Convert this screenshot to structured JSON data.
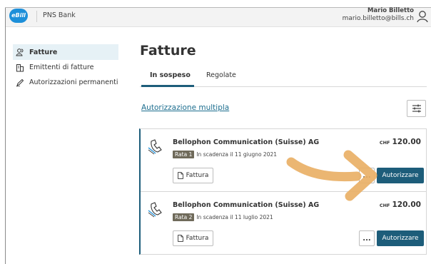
{
  "topbar": {
    "logo_text": "eBill",
    "bank_name": "PNS Bank",
    "user_name": "Mario Billetto",
    "user_email": "mario.billetto@bills.ch"
  },
  "sidebar": {
    "items": [
      {
        "label": "Fatture",
        "icon": "users-icon",
        "active": true
      },
      {
        "label": "Emittenti di fatture",
        "icon": "building-icon",
        "active": false
      },
      {
        "label": "Autorizzazioni permanenti",
        "icon": "pen-icon",
        "active": false
      }
    ]
  },
  "main": {
    "title": "Fatture",
    "tabs": [
      {
        "label": "In sospeso",
        "active": true
      },
      {
        "label": "Regolate",
        "active": false
      }
    ],
    "multi_auth_link": "Autorizzazione multipla",
    "bills": [
      {
        "issuer": "Bellophon Communication (Suisse) AG",
        "currency": "CHF",
        "amount": "120.00",
        "installment": "Rata 1",
        "due_text": "In scadenza il 11 giugno 2021",
        "invoice_label": "Fattura",
        "more_label": "...",
        "authorize_label": "Autorizzare"
      },
      {
        "issuer": "Bellophon Communication (Suisse) AG",
        "currency": "CHF",
        "amount": "120.00",
        "installment": "Rata 2",
        "due_text": "In scadenza il 11 luglio 2021",
        "invoice_label": "Fattura",
        "more_label": "...",
        "authorize_label": "Autorizzare"
      }
    ]
  },
  "colors": {
    "accent": "#1d5d7a",
    "logo": "#1d8fd9",
    "arrow": "#e9b066",
    "badge": "#6f6a5a"
  }
}
